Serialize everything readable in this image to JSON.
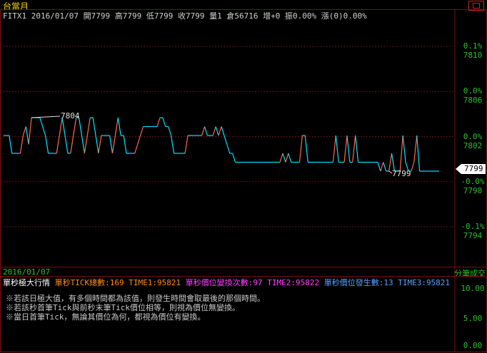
{
  "title": "台當月",
  "window_icon": "restore-window-icon",
  "quote": {
    "symbol": "FITX1",
    "date": "2016/01/07",
    "open_label": "開",
    "open": "7799",
    "high_label": "高",
    "high": "7799",
    "low_label": "低",
    "low": "7799",
    "close_label": "收",
    "close": "7799",
    "vol_label": "量",
    "vol": "1",
    "oi_label": "倉",
    "oi": "56716",
    "inc_label": "增",
    "inc": "+0",
    "amp_label": "振",
    "amp": "0.00%",
    "chg_label": "漲",
    "chg": "(0)0.00%"
  },
  "price_axis": {
    "labels": [
      {
        "pct": "0.1%",
        "price": "7810"
      },
      {
        "pct": "0.0%",
        "price": "7806"
      },
      {
        "pct": "0.0%",
        "price": "7802"
      },
      {
        "pct": "-0.0%",
        "price": "7798"
      },
      {
        "pct": "-0.1%",
        "price": "7794"
      }
    ],
    "current_price": "7799"
  },
  "annotations": {
    "high": "7804",
    "low": "7799"
  },
  "footer_date": "2016/01/07",
  "footer_tab": "分筆成交",
  "indicator": {
    "name": "單秒極大行情",
    "tick_total_label": "單秒TICK總數:169",
    "time1_label": "TIME1:95821",
    "price_change_label": "單秒價位變換次數:97",
    "time2_label": "TIME2:95822",
    "new_price_label": "單秒價位發生數:13",
    "time3_label": "TIME3:95821"
  },
  "lower_axis": [
    "10.00",
    "5.00",
    "0.00"
  ],
  "notes": [
    "※若該日極大值，有多個時間都為該值，則發生時間會取最後的那個時間。",
    "※若該秒首筆Tick與前秒末筆Tick價位相等，則視為價位無變換。",
    "※當日首筆Tick，無論其價位為何，都視為價位有變換。"
  ],
  "colors": {
    "background": "#000000",
    "frame": "#7a1010",
    "grid": "#6a1010",
    "axis_text": "#2bbf2b",
    "title": "#ffd700",
    "up_line": "#ff6a4a",
    "down_line": "#00e5ff",
    "tick_total": "#ff8c1a",
    "price_change": "#ff3fff",
    "new_price": "#5aa0ff"
  },
  "chart_data": {
    "type": "line",
    "ylim": [
      7792,
      7812
    ],
    "y_ticks": [
      7810,
      7806,
      7802,
      7798,
      7794
    ],
    "series": [
      {
        "values": [
          7802,
          7802,
          7802,
          7800,
          7800,
          7800,
          7800,
          7802,
          7803,
          7801,
          7804,
          7804,
          7804,
          7804,
          7803,
          7802,
          7800,
          7800,
          7800,
          7800,
          7802,
          7804,
          7802,
          7800,
          7800,
          7802,
          7804,
          7804,
          7802,
          7800,
          7802,
          7804,
          7804,
          7802,
          7800,
          7802,
          7802,
          7802,
          7802,
          7800,
          7802,
          7804,
          7802,
          7802,
          7800,
          7800,
          7800,
          7800,
          7801,
          7802,
          7803,
          7803,
          7803,
          7803,
          7803,
          7803,
          7804,
          7804,
          7803,
          7803,
          7802,
          7800,
          7800,
          7800,
          7800,
          7800,
          7802,
          7802,
          7802,
          7802,
          7802,
          7802,
          7803,
          7802,
          7802,
          7802,
          7803,
          7802,
          7803,
          7802,
          7801,
          7800,
          7800,
          7799,
          7799,
          7799,
          7799,
          7799,
          7799,
          7799,
          7799,
          7799,
          7799,
          7799,
          7799,
          7799,
          7799,
          7799,
          7799,
          7799,
          7800,
          7799,
          7800,
          7799,
          7799,
          7799,
          7799,
          7802,
          7802,
          7799,
          7799,
          7799,
          7799,
          7799,
          7799,
          7799,
          7799,
          7799,
          7799,
          7802,
          7799,
          7799,
          7799,
          7802,
          7799,
          7799,
          7802,
          7799,
          7799,
          7799,
          7799,
          7799,
          7799,
          7799,
          7799,
          7798,
          7799,
          7798,
          7798,
          7800,
          7798,
          7798,
          7798,
          7802,
          7799,
          7798,
          7798,
          7799,
          7802,
          7798,
          7798,
          7798,
          7798,
          7798,
          7798,
          7798,
          7798
        ]
      }
    ]
  }
}
